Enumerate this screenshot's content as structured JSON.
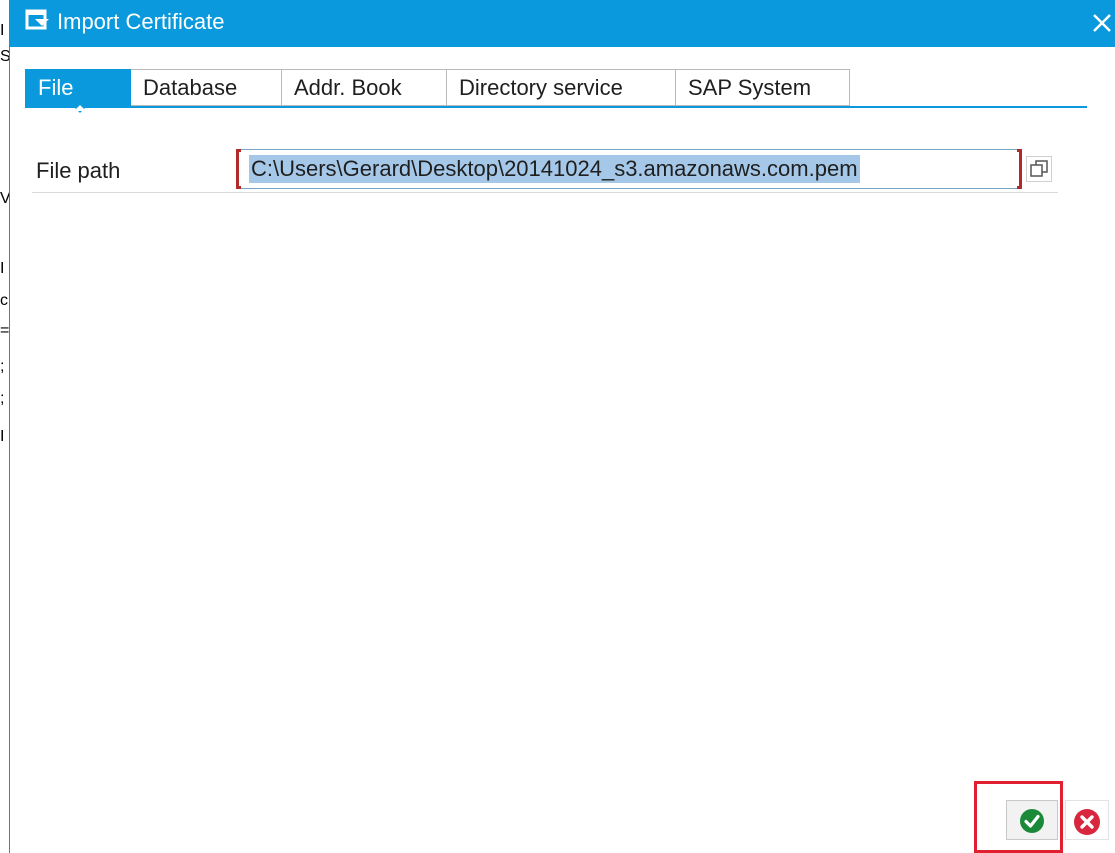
{
  "dialog": {
    "title": "Import Certificate",
    "close_icon": "close-icon"
  },
  "tabs": [
    {
      "label": "File",
      "active": true
    },
    {
      "label": "Database",
      "active": false
    },
    {
      "label": "Addr. Book",
      "active": false
    },
    {
      "label": "Directory service",
      "active": false
    },
    {
      "label": "SAP System",
      "active": false
    }
  ],
  "form": {
    "file_path_label": "File path",
    "file_path_value": "C:\\Users\\Gerard\\Desktop\\20141024_s3.amazonaws.com.pem",
    "value_help_icon": "value-help-icon"
  },
  "actions": {
    "ok_icon": "checkmark-icon",
    "cancel_icon": "cancel-icon"
  },
  "colors": {
    "title_bar": "#0a99dd",
    "selection": "#a6c8e8",
    "required_bracket": "#b22b2b",
    "highlight": "#e0202e",
    "ok_green": "#1a8a3a",
    "cancel_red": "#d7263d"
  }
}
